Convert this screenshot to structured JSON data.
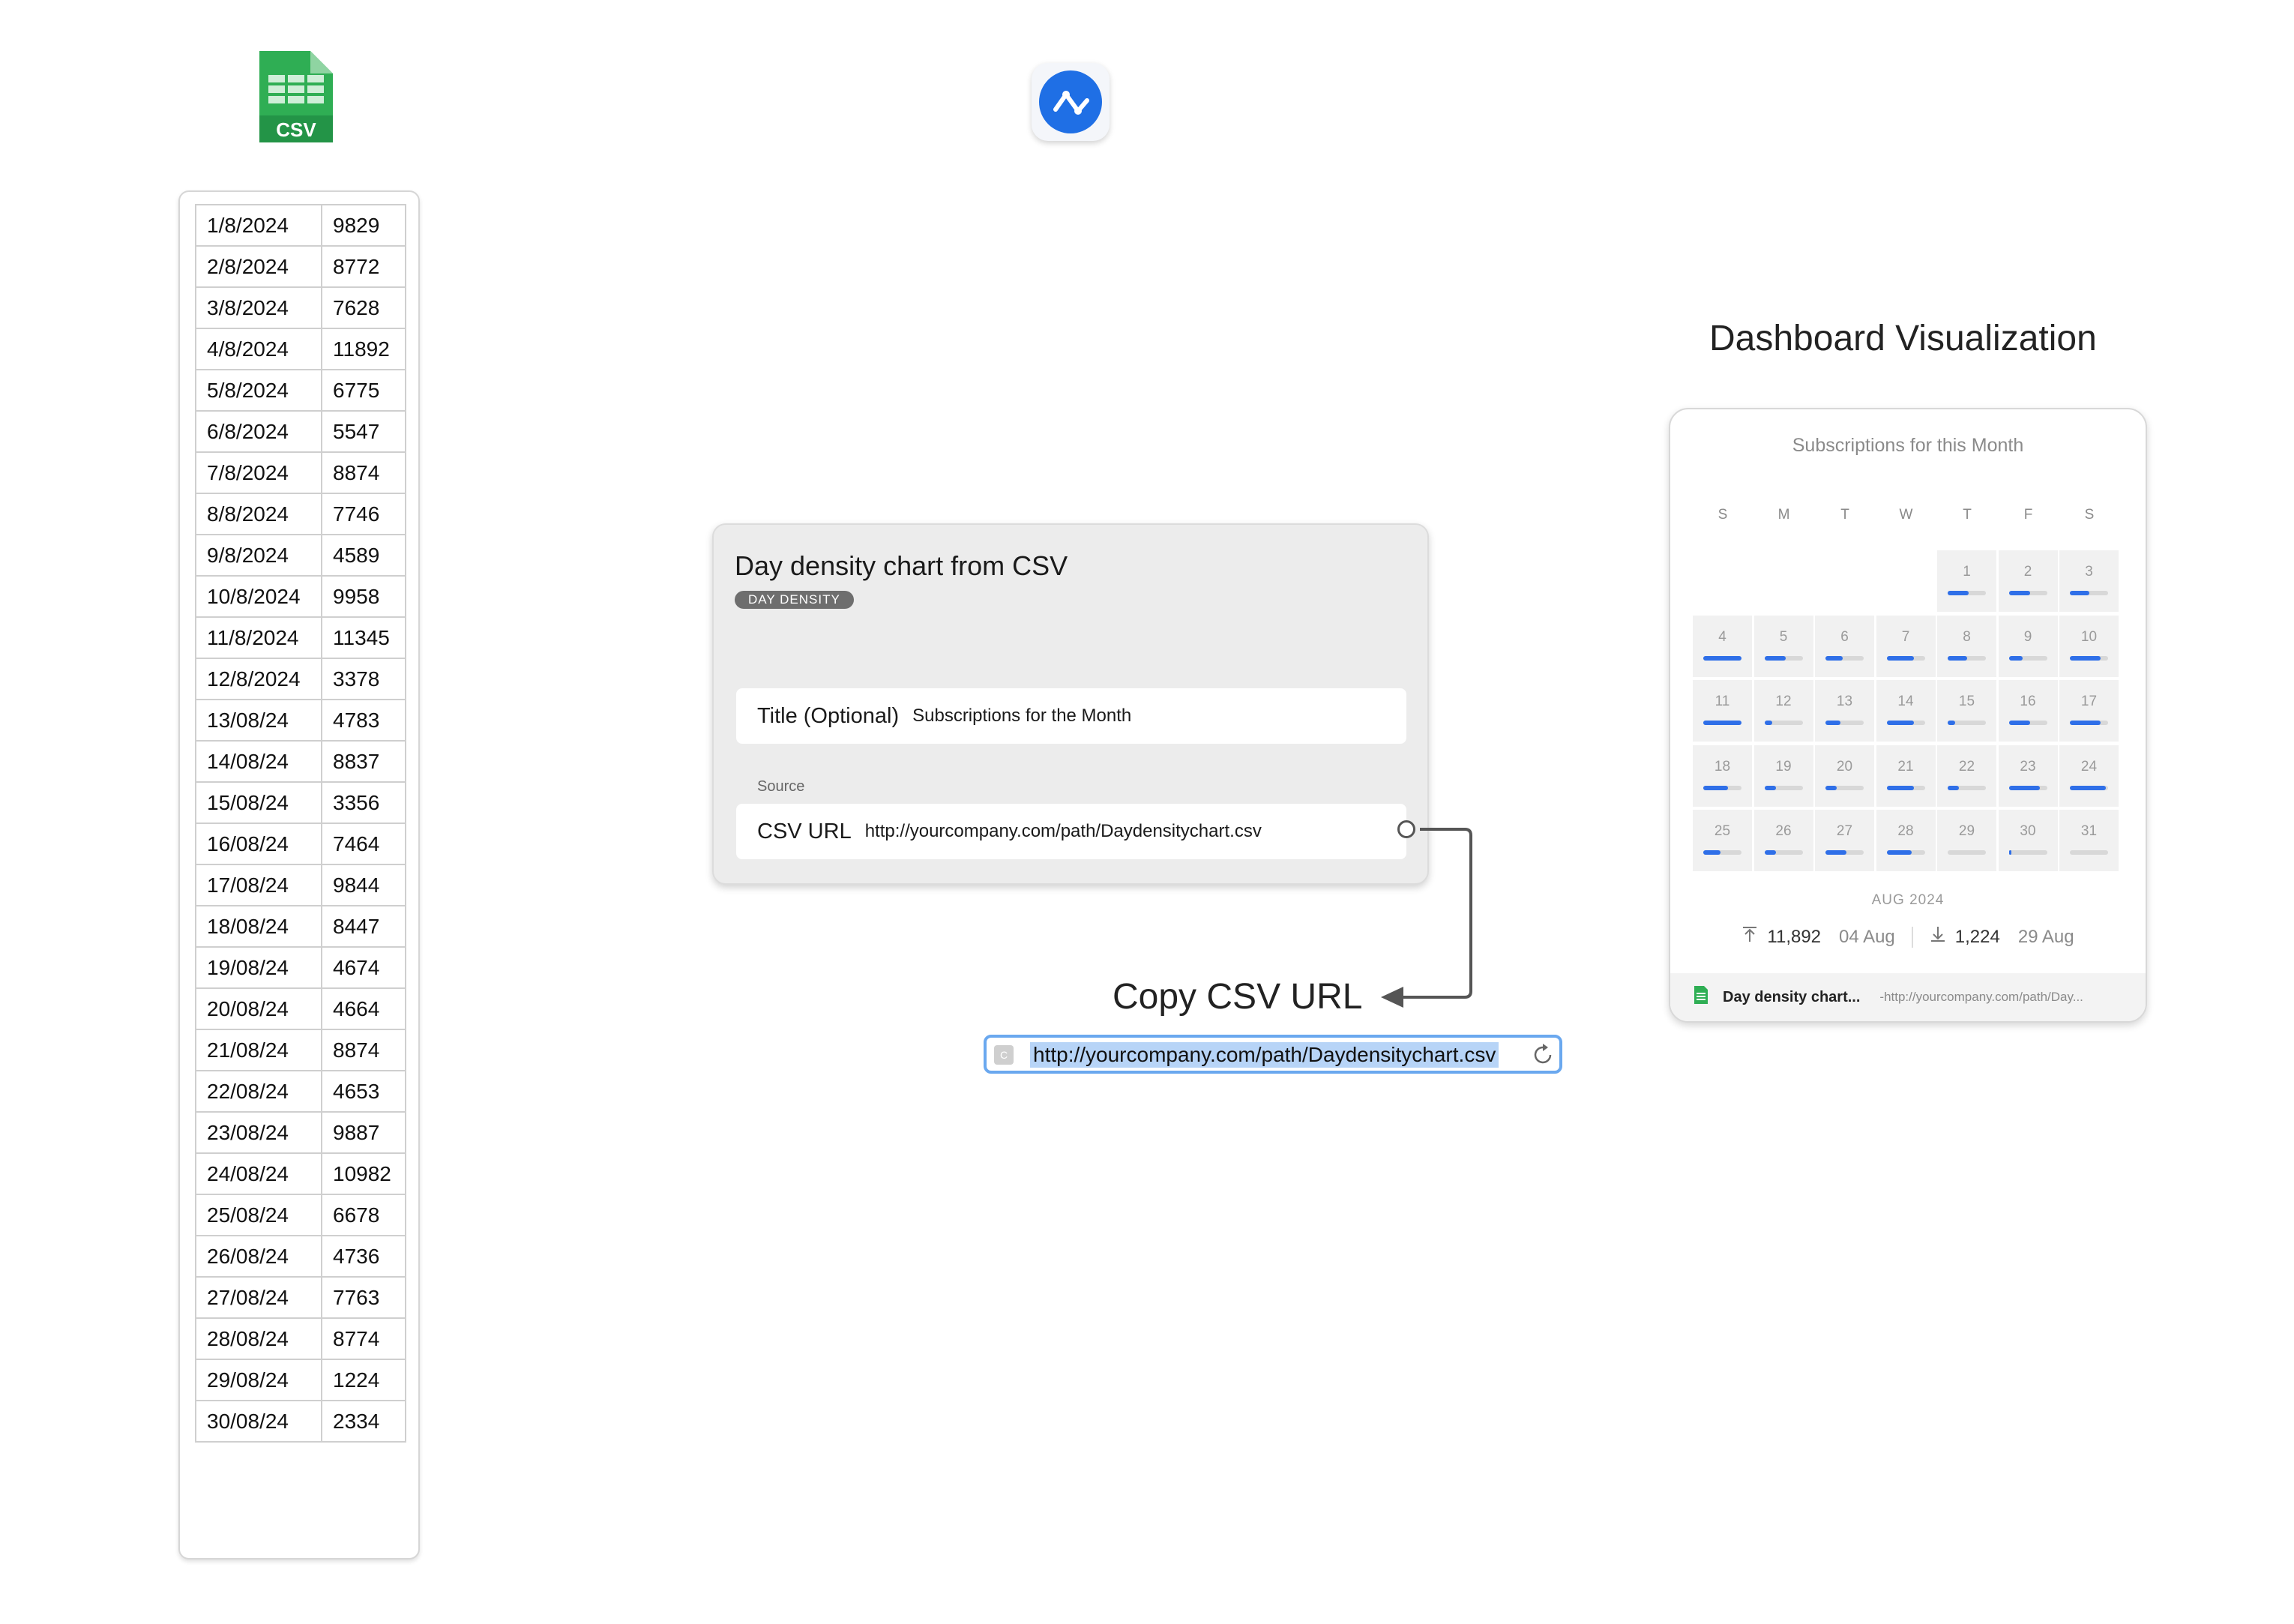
{
  "csv_icon": {
    "label": "CSV"
  },
  "csv_table": {
    "rows": [
      [
        "1/8/2024",
        "9829"
      ],
      [
        "2/8/2024",
        "8772"
      ],
      [
        "3/8/2024",
        "7628"
      ],
      [
        "4/8/2024",
        "11892"
      ],
      [
        "5/8/2024",
        "6775"
      ],
      [
        "6/8/2024",
        "5547"
      ],
      [
        "7/8/2024",
        "8874"
      ],
      [
        "8/8/2024",
        "7746"
      ],
      [
        "9/8/2024",
        "4589"
      ],
      [
        "10/8/2024",
        "9958"
      ],
      [
        "11/8/2024",
        "11345"
      ],
      [
        "12/8/2024",
        "3378"
      ],
      [
        "13/08/24",
        "4783"
      ],
      [
        "14/08/24",
        "8837"
      ],
      [
        "15/08/24",
        "3356"
      ],
      [
        "16/08/24",
        "7464"
      ],
      [
        "17/08/24",
        "9844"
      ],
      [
        "18/08/24",
        "8447"
      ],
      [
        "19/08/24",
        "4674"
      ],
      [
        "20/08/24",
        "4664"
      ],
      [
        "21/08/24",
        "8874"
      ],
      [
        "22/08/24",
        "4653"
      ],
      [
        "23/08/24",
        "9887"
      ],
      [
        "24/08/24",
        "10982"
      ],
      [
        "25/08/24",
        "6678"
      ],
      [
        "26/08/24",
        "4736"
      ],
      [
        "27/08/24",
        "7763"
      ],
      [
        "28/08/24",
        "8774"
      ],
      [
        "29/08/24",
        "1224"
      ],
      [
        "30/08/24",
        "2334"
      ]
    ]
  },
  "editor": {
    "title": "Day density chart from CSV",
    "badge": "DAY DENSITY",
    "title_field_label": "Title (Optional)",
    "title_field_value": "Subscriptions for the Month",
    "source_label": "Source",
    "url_field_label": "CSV URL",
    "url_field_value": "http://yourcompany.com/path/Daydensitychart.csv"
  },
  "copy": {
    "heading": "Copy CSV URL",
    "url": "http://yourcompany.com/path/Daydensitychart.csv",
    "favicon_letter": "C"
  },
  "dashboard": {
    "heading": "Dashboard Visualization",
    "title": "Subscriptions for this Month",
    "weekdays": [
      "S",
      "M",
      "T",
      "W",
      "T",
      "F",
      "S"
    ],
    "first_weekday_index": 4,
    "days": [
      {
        "n": "1",
        "level": 0.55
      },
      {
        "n": "2",
        "level": 0.55
      },
      {
        "n": "3",
        "level": 0.5
      },
      {
        "n": "4",
        "level": 1.0
      },
      {
        "n": "5",
        "level": 0.55
      },
      {
        "n": "6",
        "level": 0.45
      },
      {
        "n": "7",
        "level": 0.7
      },
      {
        "n": "8",
        "level": 0.5
      },
      {
        "n": "9",
        "level": 0.35
      },
      {
        "n": "10",
        "level": 0.8
      },
      {
        "n": "11",
        "level": 1.0
      },
      {
        "n": "12",
        "level": 0.2
      },
      {
        "n": "13",
        "level": 0.4
      },
      {
        "n": "14",
        "level": 0.7
      },
      {
        "n": "15",
        "level": 0.2
      },
      {
        "n": "16",
        "level": 0.55
      },
      {
        "n": "17",
        "level": 0.8
      },
      {
        "n": "18",
        "level": 0.65
      },
      {
        "n": "19",
        "level": 0.3
      },
      {
        "n": "20",
        "level": 0.3
      },
      {
        "n": "21",
        "level": 0.7
      },
      {
        "n": "22",
        "level": 0.3
      },
      {
        "n": "23",
        "level": 0.8
      },
      {
        "n": "24",
        "level": 0.95
      },
      {
        "n": "25",
        "level": 0.45
      },
      {
        "n": "26",
        "level": 0.3
      },
      {
        "n": "27",
        "level": 0.55
      },
      {
        "n": "28",
        "level": 0.65
      },
      {
        "n": "29",
        "level": 0.0
      },
      {
        "n": "30",
        "level": 0.05
      },
      {
        "n": "31",
        "level": 0.0
      }
    ],
    "month_label": "AUG 2024",
    "max_value": "11,892",
    "max_date": "04 Aug",
    "min_value": "1,224",
    "min_date": "29 Aug",
    "footer_title": "Day density chart...",
    "footer_url": "-http://yourcompany.com/path/Day...",
    "accent_color": "#2f6fe8"
  }
}
